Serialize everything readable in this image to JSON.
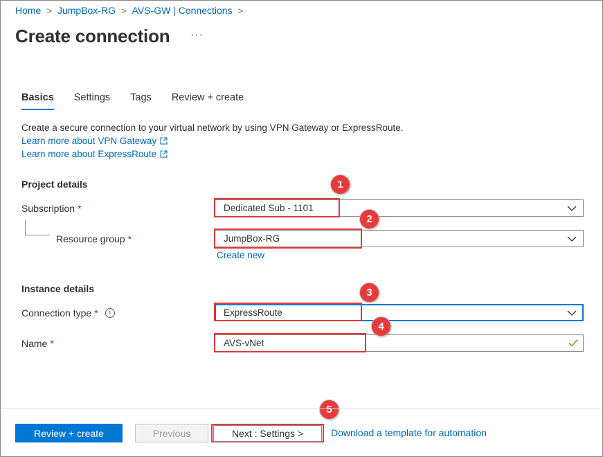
{
  "breadcrumb": {
    "items": [
      "Home",
      "JumpBox-RG",
      "AVS-GW | Connections"
    ],
    "separator": ">"
  },
  "page": {
    "title": "Create connection",
    "more_label": "···"
  },
  "tabs": [
    {
      "label": "Basics",
      "active": true
    },
    {
      "label": "Settings",
      "active": false
    },
    {
      "label": "Tags",
      "active": false
    },
    {
      "label": "Review + create",
      "active": false
    }
  ],
  "intro": {
    "description": "Create a secure connection to your virtual network by using VPN Gateway or ExpressRoute.",
    "learn_vpn": "Learn more about VPN Gateway",
    "learn_expressroute": "Learn more about ExpressRoute",
    "external_icon": "external-link-icon"
  },
  "project_details": {
    "heading": "Project details",
    "subscription": {
      "label": "Subscription",
      "value": "Dedicated Sub - 1101"
    },
    "resource_group": {
      "label": "Resource group",
      "value": "JumpBox-RG",
      "create_new": "Create new"
    }
  },
  "instance_details": {
    "heading": "Instance details",
    "connection_type": {
      "label": "Connection type",
      "value": "ExpressRoute",
      "info_icon": "info-icon"
    },
    "name": {
      "label": "Name",
      "value": "AVS-vNet"
    }
  },
  "required_marker": "*",
  "info_glyph": "i",
  "footer": {
    "review_create": "Review + create",
    "previous": "Previous",
    "next": "Next : Settings >",
    "download": "Download a template for automation"
  },
  "callouts": [
    "1",
    "2",
    "3",
    "4",
    "5"
  ],
  "colors": {
    "accent": "#0078d4",
    "link": "#0067b8",
    "required": "#a4262c",
    "callout": "#e83a3a",
    "valid_check": "#57a300"
  }
}
